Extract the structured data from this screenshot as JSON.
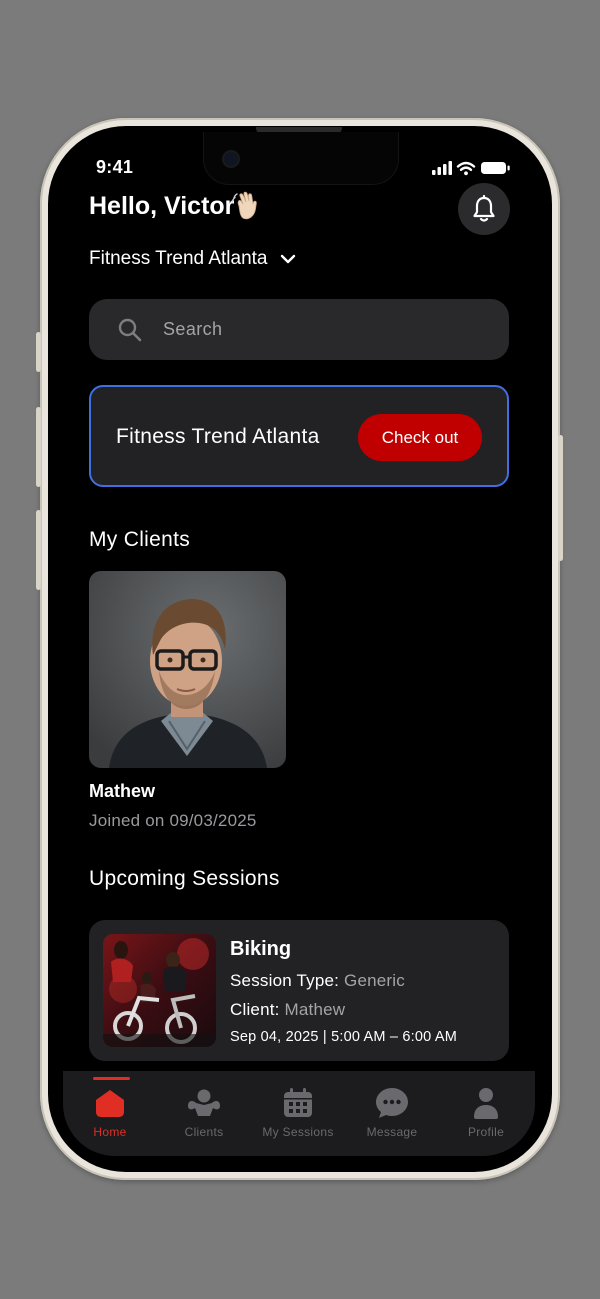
{
  "status_bar": {
    "time": "9:41"
  },
  "header": {
    "greeting": "Hello, Victor",
    "location": "Fitness Trend Atlanta"
  },
  "search": {
    "placeholder": "Search"
  },
  "checkin_card": {
    "gym_name": "Fitness Trend Atlanta",
    "button_label": "Check out",
    "accent_color": "#3f6fe0",
    "button_color": "#c00000"
  },
  "clients_section": {
    "title": "My Clients",
    "clients": [
      {
        "name": "Mathew",
        "joined": "Joined on 09/03/2025"
      }
    ]
  },
  "sessions_section": {
    "title": "Upcoming Sessions",
    "sessions": [
      {
        "title": "Biking",
        "type_label": "Session Type:",
        "type_value": "Generic",
        "client_label": "Client:",
        "client_value": "Mathew",
        "datetime": "Sep 04, 2025 | 5:00 AM – 6:00 AM"
      }
    ]
  },
  "tabbar": {
    "tabs": [
      {
        "label": "Home",
        "icon": "home-icon",
        "active": true
      },
      {
        "label": "Clients",
        "icon": "clients-icon",
        "active": false
      },
      {
        "label": "My Sessions",
        "icon": "calendar-icon",
        "active": false
      },
      {
        "label": "Message",
        "icon": "message-icon",
        "active": false
      },
      {
        "label": "Profile",
        "icon": "profile-icon",
        "active": false
      }
    ],
    "active_color": "#e02e24"
  }
}
